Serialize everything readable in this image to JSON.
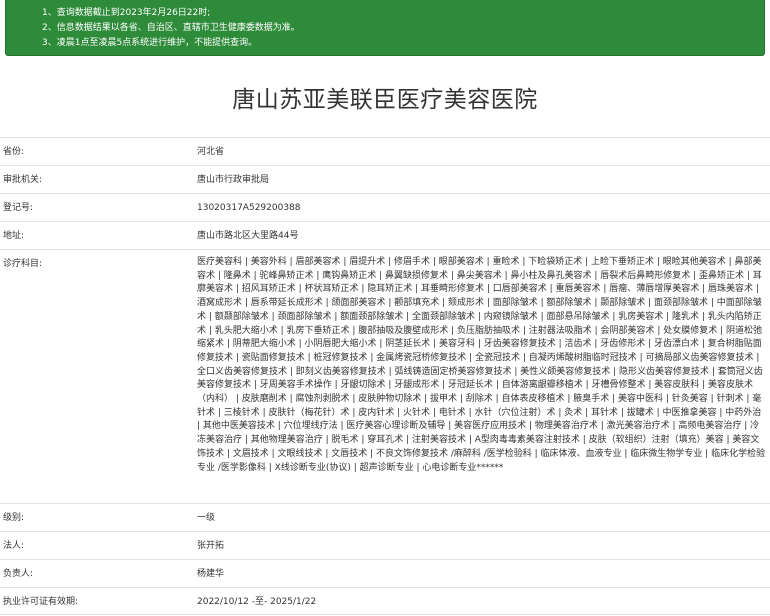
{
  "notice": {
    "lines": [
      "1、查询数据截止到2023年2月26日22时;",
      "2、信息数据结果以各省、自治区、直辖市卫生健康委数据为准。",
      "3、凌晨1点至凌晨5点系统进行维护，不能提供查询。"
    ],
    "bg_color": "#2e8b3a"
  },
  "hospital": {
    "name": "唐山苏亚美联臣医疗美容医院"
  },
  "fields": {
    "province": {
      "label": "省份:",
      "value": "河北省"
    },
    "authority": {
      "label": "审批机关:",
      "value": "唐山市行政审批局"
    },
    "reg_no": {
      "label": "登记号:",
      "value": "13020317A529200388"
    },
    "address": {
      "label": "地址:",
      "value": "唐山市路北区大里路44号"
    },
    "subjects": {
      "label": "诊疗科目:",
      "value": "医疗美容科 | 美容外科 | 眉部美容术 | 眉提升术 | 修眉手术 | 眼部美容术 | 重睑术 | 下睑袋矫正术 | 上睑下垂矫正术 | 眼睑其他美容术 | 鼻部美容术 | 隆鼻术 | 驼峰鼻矫正术 | 鹰钩鼻矫正术 | 鼻翼缺损修复术 | 鼻尖美容术 | 鼻小柱及鼻孔美容术 | 唇裂术后鼻畸形修复术 | 歪鼻矫正术 | 耳廓美容术 | 招风耳矫正术 | 杯状耳矫正术 | 隐耳矫正术 | 耳垂畸形修复术 | 口唇部美容术 | 重唇美容术 | 唇瘤、薄唇增厚美容术 | 唇珠美容术 | 酒窝成形术 | 唇系带延长成形术 | 颌面部美容术 | 颧部填充术 | 颏成形术 | 面部除皱术 | 额部除皱术 | 颞部除皱术 | 面颈部除皱术 | 中面部除皱术 | 额颞部除皱术 | 颈面部除皱术 | 额面颈部除皱术 | 全面颈部除皱术 | 内窥镜除皱术 | 面部悬吊除皱术 | 乳房美容术 | 隆乳术 | 乳头内陷矫正术 | 乳头肥大缩小术 | 乳房下垂矫正术 | 腹部抽吸及腹壁成形术 | 负压脂肪抽吸术 | 注射器法吸脂术 | 会阴部美容术 | 处女膜修复术 | 阴道松弛缩紧术 | 阴蒂肥大缩小术 | 小阴唇肥大缩小术 | 阴茎延长术 | 美容牙科 | 牙齿美容修复技术 | 洁齿术 | 牙齿修形术 | 牙齿漂白术 | 复合树脂贴面修复技术 | 瓷贴面修复技术 | 桩冠修复技术 | 金属烤瓷冠桥修复技术 | 全瓷冠技术 | 自凝丙烯酸树脂临时冠技术 | 可摘局部义齿美容修复技术 | 全口义齿美容修复技术 | 即刻义齿美容修复技术 | 弧线铸造固定桥美容修复技术 | 美性义颌美容修复技术 | 隐形义齿美容修复技术 | 套筒冠义齿美容修复技术 | 牙周美容手术操作 | 牙龈切除术 | 牙龈成形术 | 牙冠延长术 | 自体游离龈瓣移植术 | 牙槽骨修整术 | 美容皮肤科 | 美容皮肤术（内科） | 皮肤磨削术 | 腐蚀剂剥脱术 | 皮肤肿物切除术 | 拔甲术 | 刮除术 | 自体表皮移植术 | 腋臭手术 | 美容中医科 | 针灸美容 | 针刺术 | 毫针术 | 三棱针术 | 皮肤针（梅花针）术 | 皮内针术 | 火针术 | 电针术 | 水针（穴位注射）术 | 灸术 | 耳针术 | 拔罐术 | 中医推拿美容 | 中药外治 | 其他中医美容技术 | 穴位埋线疗法 | 医疗美容心理诊断及辅导 | 美容医疗应用技术 | 物理美容治疗术 | 激光美容治疗术 | 高频电美容治疗 | 冷冻美容治疗 | 其他物理美容治疗 | 脱毛术 | 穿耳孔术 | 注射美容技术 | A型肉毒毒素美容注射技术 | 皮肤（软组织）注射（填充）美容 | 美容文饰技术 | 文眉技术 | 文眼线技术 | 文唇技术 | 不良文饰修复技术 /麻醉科 /医学检验科 | 临床体液、血液专业 | 临床微生物学专业 | 临床化学检验专业 /医学影像科 | X线诊断专业(协议) | 超声诊断专业 | 心电诊断专业******"
    },
    "level": {
      "label": "级别:",
      "value": "一级"
    },
    "legal_person": {
      "label": "法人:",
      "value": "张开拓"
    },
    "principal": {
      "label": "负责人:",
      "value": "杨建华"
    },
    "license_valid": {
      "label": "执业许可证有效期:",
      "value": "2022/10/12 -至- 2025/1/22"
    }
  }
}
